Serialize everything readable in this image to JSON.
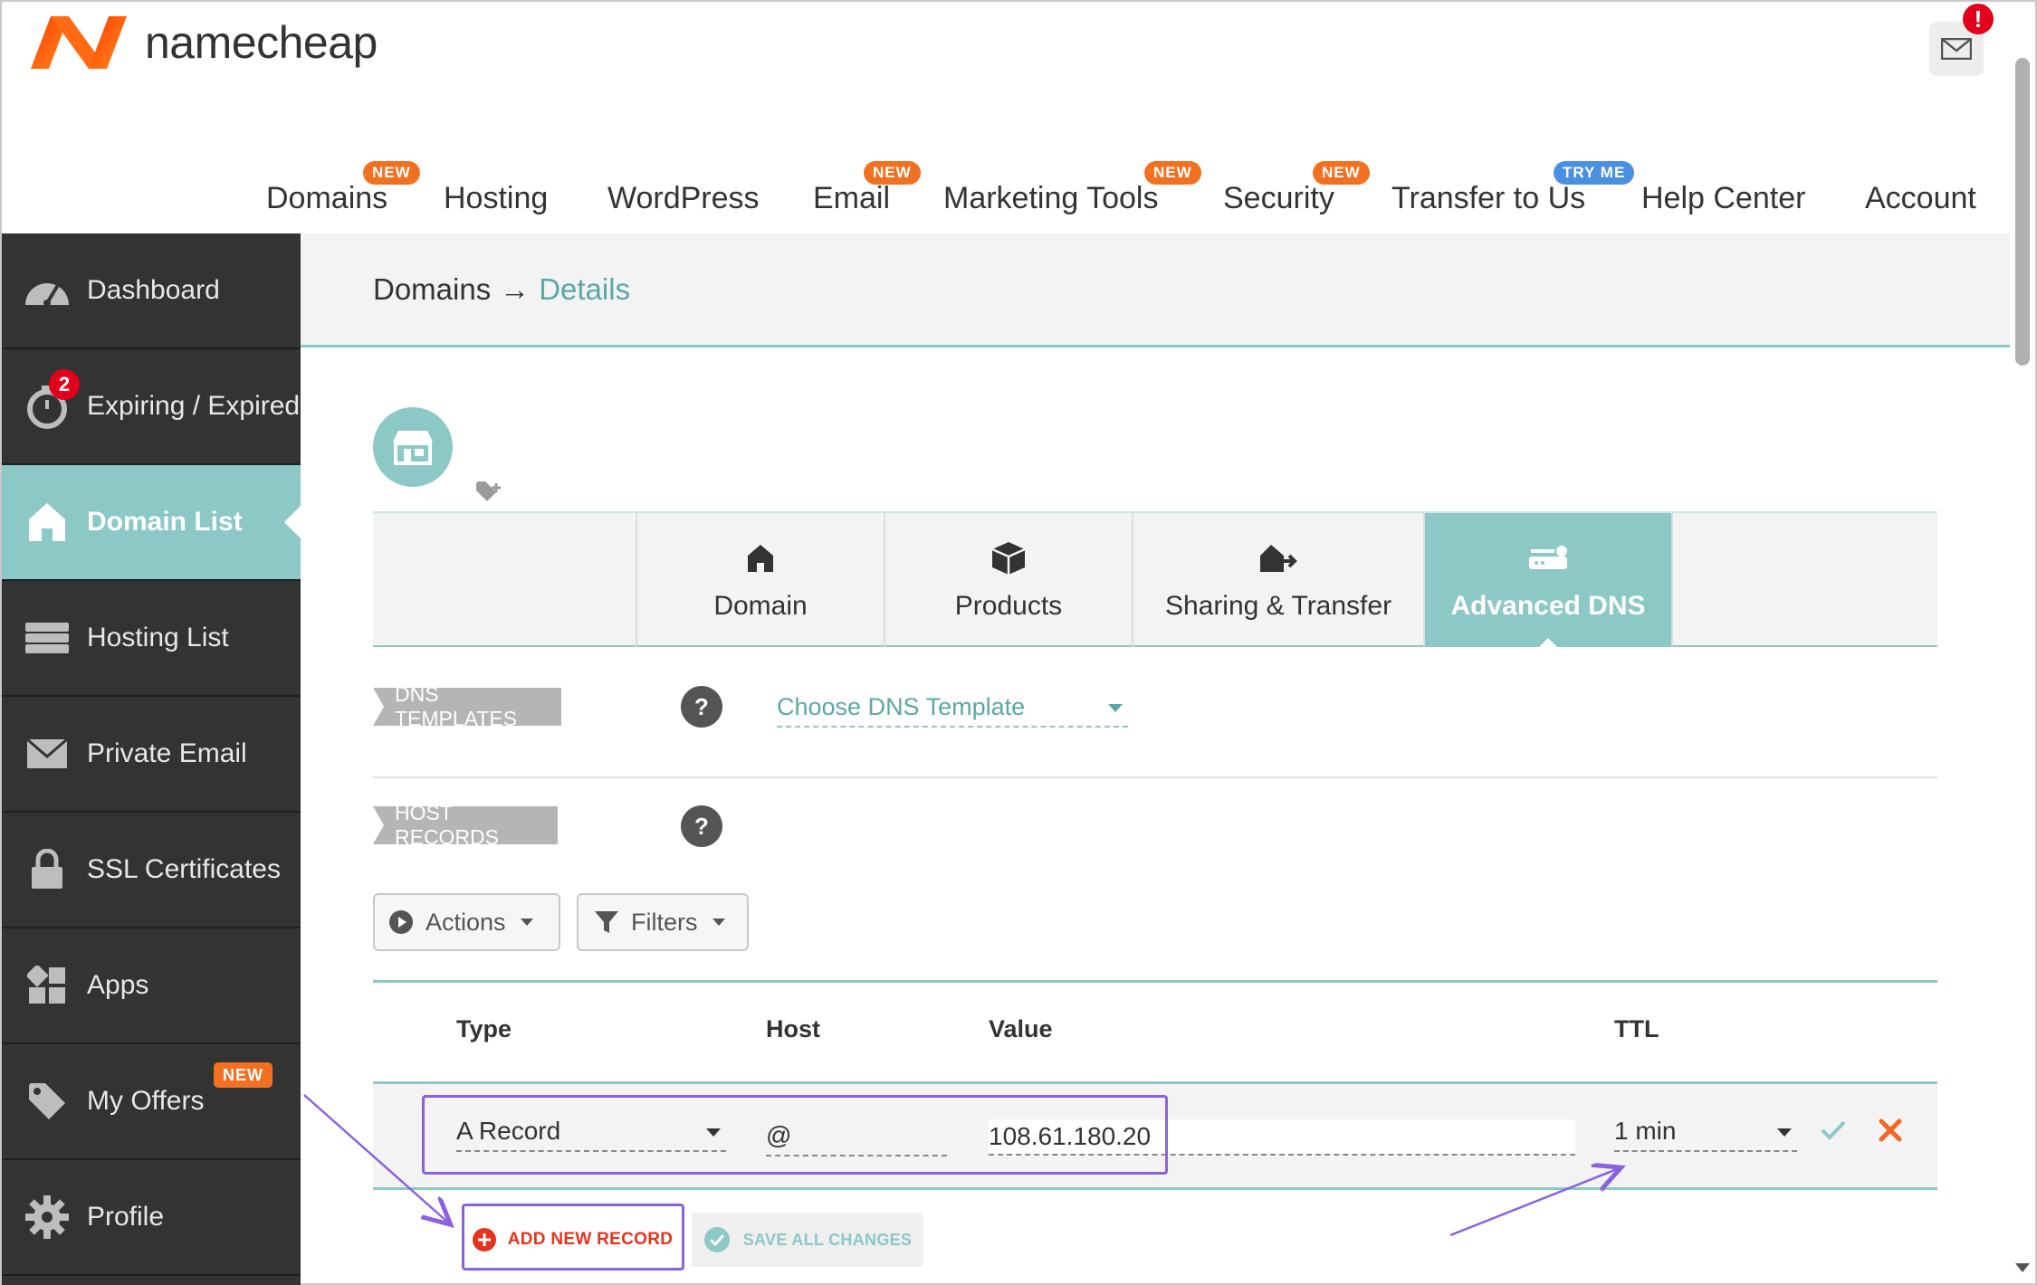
{
  "brand": {
    "name": "namecheap",
    "logo_colors": [
      "#ff5000",
      "#f37021"
    ]
  },
  "header": {
    "mail_badge": "!"
  },
  "topnav": {
    "items": [
      {
        "label": "Domains",
        "badge": "NEW"
      },
      {
        "label": "Hosting",
        "badge": ""
      },
      {
        "label": "WordPress",
        "badge": ""
      },
      {
        "label": "Email",
        "badge": "NEW"
      },
      {
        "label": "Marketing Tools",
        "badge": "NEW"
      },
      {
        "label": "Security",
        "badge": "NEW"
      },
      {
        "label": "Transfer to Us",
        "badge": "TRY ME"
      },
      {
        "label": "Help Center",
        "badge": ""
      },
      {
        "label": "Account",
        "badge": ""
      }
    ]
  },
  "sidebar": {
    "items": [
      {
        "label": "Dashboard",
        "icon": "dashboard-gauge-icon"
      },
      {
        "label": "Expiring / Expired",
        "icon": "timer-icon",
        "badge": "2"
      },
      {
        "label": "Domain List",
        "icon": "home-icon",
        "active": true
      },
      {
        "label": "Hosting List",
        "icon": "server-icon"
      },
      {
        "label": "Private Email",
        "icon": "envelope-icon"
      },
      {
        "label": "SSL Certificates",
        "icon": "lock-icon"
      },
      {
        "label": "Apps",
        "icon": "apps-grid-icon"
      },
      {
        "label": "My Offers",
        "icon": "tag-icon",
        "badge": "NEW"
      },
      {
        "label": "Profile",
        "icon": "gear-icon"
      }
    ]
  },
  "breadcrumb": {
    "parent": "Domains",
    "separator": "→",
    "current": "Details"
  },
  "tabs": [
    {
      "label": "Domain",
      "icon": "home-icon"
    },
    {
      "label": "Products",
      "icon": "box-icon"
    },
    {
      "label": "Sharing & Transfer",
      "icon": "share-home-icon"
    },
    {
      "label": "Advanced DNS",
      "icon": "router-icon",
      "active": true
    }
  ],
  "dns_templates": {
    "label": "DNS TEMPLATES",
    "help": "?",
    "select_value": "Choose DNS Template"
  },
  "host_records": {
    "label": "HOST RECORDS",
    "help": "?",
    "actions_label": "Actions",
    "filters_label": "Filters",
    "columns": [
      "Type",
      "Host",
      "Value",
      "TTL"
    ],
    "new_row": {
      "type": "A Record",
      "host": "@",
      "value": "108.61.180.20",
      "ttl": "1 min"
    },
    "add_button": "ADD NEW RECORD",
    "save_button": "SAVE ALL CHANGES"
  },
  "colors": {
    "accent": "#8cc8c6",
    "sidebar_bg": "#333333",
    "badge_orange": "#f37021",
    "badge_blue": "#4a90e2",
    "alert_red": "#e3001b",
    "annotation_purple": "#8a62e0"
  }
}
